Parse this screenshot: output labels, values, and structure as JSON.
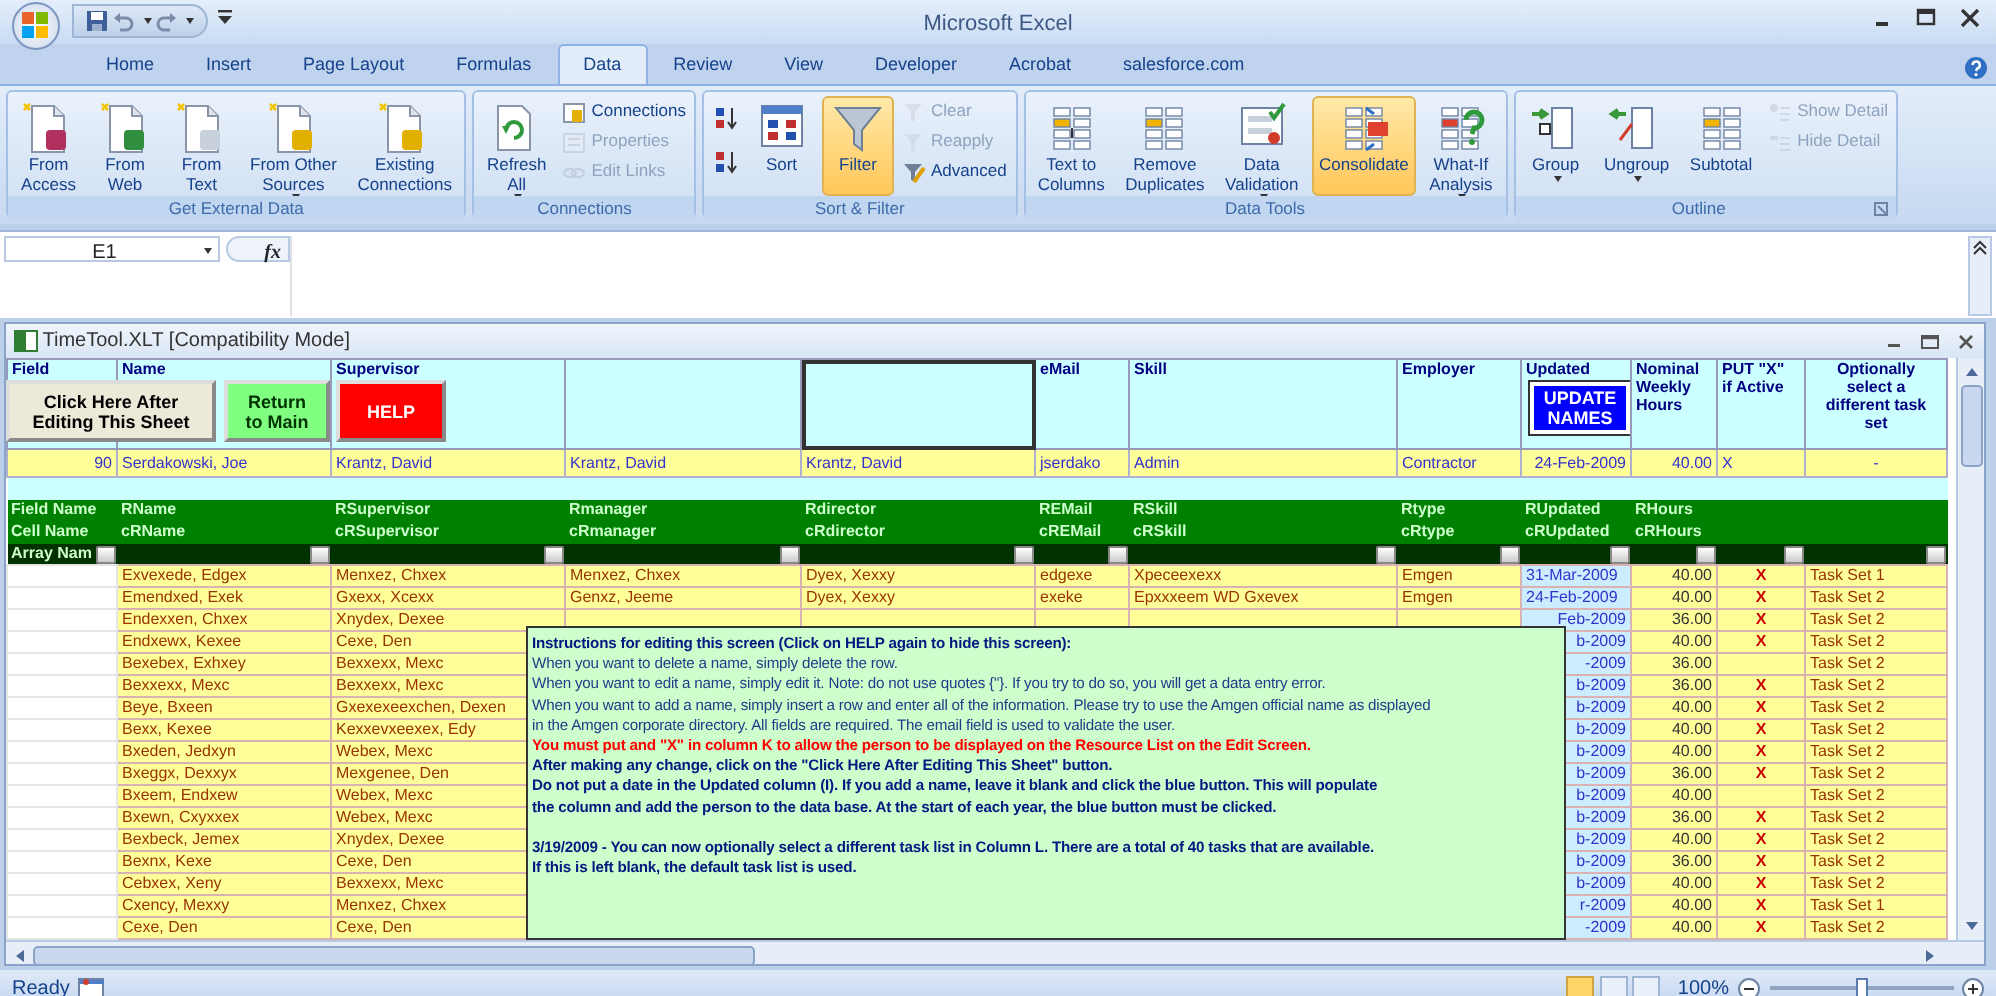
{
  "title_bar": {
    "title": "Microsoft Excel"
  },
  "tabs": [
    {
      "label": "Home",
      "selected": false
    },
    {
      "label": "Insert",
      "selected": false
    },
    {
      "label": "Page Layout",
      "selected": false
    },
    {
      "label": "Formulas",
      "selected": false
    },
    {
      "label": "Data",
      "selected": true
    },
    {
      "label": "Review",
      "selected": false
    },
    {
      "label": "View",
      "selected": false
    },
    {
      "label": "Developer",
      "selected": false
    },
    {
      "label": "Acrobat",
      "selected": false
    },
    {
      "label": "salesforce.com",
      "selected": false
    }
  ],
  "ribbon": [
    {
      "title": "Get External Data",
      "buttons": [
        {
          "kind": "large",
          "label": "From\nAccess",
          "disabled": false,
          "highlighted": false,
          "dropdown": false
        },
        {
          "kind": "large",
          "label": "From\nWeb",
          "disabled": false,
          "highlighted": false,
          "dropdown": false
        },
        {
          "kind": "large",
          "label": "From\nText",
          "disabled": false,
          "highlighted": false,
          "dropdown": false
        },
        {
          "kind": "large",
          "label": "From Other\nSources",
          "disabled": false,
          "highlighted": false,
          "dropdown": true
        },
        {
          "kind": "large",
          "label": "Existing\nConnections",
          "disabled": false,
          "highlighted": false,
          "dropdown": false
        }
      ]
    },
    {
      "title": "Connections",
      "buttons": [
        {
          "kind": "large",
          "label": "Refresh\nAll",
          "disabled": false,
          "highlighted": false,
          "dropdown": true
        },
        {
          "kind": "small",
          "label": "Connections",
          "disabled": false,
          "highlighted": false,
          "dropdown": false
        },
        {
          "kind": "small",
          "label": "Properties",
          "disabled": true,
          "highlighted": false,
          "dropdown": false
        },
        {
          "kind": "small",
          "label": "Edit Links",
          "disabled": true,
          "highlighted": false,
          "dropdown": false
        }
      ]
    },
    {
      "title": "Sort & Filter",
      "buttons": [
        {
          "kind": "icon",
          "disabled": false,
          "highlighted": false,
          "dropdown": false
        },
        {
          "kind": "icon",
          "disabled": false,
          "highlighted": false,
          "dropdown": false
        },
        {
          "kind": "large",
          "label": "Sort",
          "disabled": false,
          "highlighted": false,
          "dropdown": false
        },
        {
          "kind": "large",
          "label": "Filter",
          "disabled": false,
          "highlighted": true,
          "dropdown": false
        },
        {
          "kind": "small",
          "label": "Clear",
          "disabled": true,
          "highlighted": false,
          "dropdown": false
        },
        {
          "kind": "small",
          "label": "Reapply",
          "disabled": true,
          "highlighted": false,
          "dropdown": false
        },
        {
          "kind": "small",
          "label": "Advanced",
          "disabled": false,
          "highlighted": false,
          "dropdown": false
        }
      ]
    },
    {
      "title": "Data Tools",
      "buttons": [
        {
          "kind": "large",
          "label": "Text to\nColumns",
          "disabled": false,
          "highlighted": false,
          "dropdown": false
        },
        {
          "kind": "large",
          "label": "Remove\nDuplicates",
          "disabled": false,
          "highlighted": false,
          "dropdown": false
        },
        {
          "kind": "large",
          "label": "Data\nValidation",
          "disabled": false,
          "highlighted": false,
          "dropdown": true
        },
        {
          "kind": "large",
          "label": "Consolidate",
          "disabled": false,
          "highlighted": true,
          "dropdown": false
        },
        {
          "kind": "large",
          "label": "What-If\nAnalysis",
          "disabled": false,
          "highlighted": false,
          "dropdown": true
        }
      ]
    },
    {
      "title": "Outline",
      "buttons": [
        {
          "kind": "large",
          "label": "Group",
          "disabled": false,
          "highlighted": false,
          "dropdown": true
        },
        {
          "kind": "large",
          "label": "Ungroup",
          "disabled": false,
          "highlighted": false,
          "dropdown": true
        },
        {
          "kind": "large",
          "label": "Subtotal",
          "disabled": false,
          "highlighted": false,
          "dropdown": false
        },
        {
          "kind": "small",
          "label": "Show Detail",
          "disabled": true,
          "highlighted": false,
          "dropdown": false
        },
        {
          "kind": "small",
          "label": "Hide Detail",
          "disabled": true,
          "highlighted": false,
          "dropdown": false
        }
      ]
    }
  ],
  "formula_bar": {
    "name_box": "E1",
    "function_label": "fx"
  },
  "workbook": {
    "title": "TimeTool.XLT  [Compatibility Mode]"
  },
  "sheet_buttons": [
    {
      "kind": "beige",
      "label": "Click Here After\nEditing This Sheet"
    },
    {
      "kind": "green",
      "label": "Return\nto Main"
    },
    {
      "kind": "red",
      "label": "HELP"
    },
    {
      "kind": "blue",
      "label": "UPDATE\nNAMES"
    }
  ],
  "header_row": [
    {
      "text": "Field",
      "selected": false
    },
    {
      "text": "Name",
      "selected": false
    },
    {
      "text": "Supervisor",
      "selected": false
    },
    {
      "selected": false
    },
    {
      "selected": true
    },
    {
      "text": "eMail",
      "selected": false
    },
    {
      "text": "Skill",
      "selected": false
    },
    {
      "text": "Employer",
      "selected": false
    },
    {
      "text": "Updated",
      "selected": false
    },
    {
      "text": "Nominal\nWeekly\nHours",
      "selected": false
    },
    {
      "text": "PUT \"X\"\nif Active",
      "selected": false
    },
    {
      "text": "Optionally\nselect a\ndifferent task\nset",
      "selected": false
    }
  ],
  "record_row": [
    "90",
    "Serdakowski, Joe",
    "Krantz, David",
    "Krantz, David",
    "Krantz, David",
    "jserdako",
    "Admin",
    "Contractor",
    "24-Feb-2009",
    "40.00",
    "X",
    "-"
  ],
  "field_rows": [
    [
      "Field Name",
      "RName",
      "RSupervisor",
      "Rmanager",
      "Rdirector",
      "REMail",
      "RSkill",
      "Rtype",
      "RUpdated",
      "RHours"
    ],
    [
      "Cell Name",
      "cRName",
      "cRSupervisor",
      "cRmanager",
      "cRdirector",
      "cREMail",
      "cRSkill",
      "cRtype",
      "cRUpdated",
      "cRHours"
    ],
    [
      "Array Nam"
    ]
  ],
  "data_rows": [
    {
      "name": "Exvexede, Edgex",
      "supervisor": "Menxez, Chxex",
      "manager": "Menxez, Chxex",
      "director": "Dyex, Xexxy",
      "email": "edgexe",
      "skill": "Xpeceexexx",
      "type": "Emgen",
      "updated": "31-Mar-2009",
      "hours": "40.00",
      "active": "X",
      "task_set": "Task Set 1"
    },
    {
      "name": "Emendxed, Exek",
      "supervisor": "Gxexx, Xcexx",
      "manager": "Genxz, Jeeme",
      "director": "Dyex, Xexxy",
      "email": "exeke",
      "skill": "Epxxxeem WD Gxevex",
      "type": "Emgen",
      "updated": "24-Feb-2009",
      "hours": "40.00",
      "active": "X",
      "task_set": "Task Set 2"
    },
    {
      "name": "Endexxen, Chxex",
      "supervisor": "Xnydex, Dexee",
      "updated": "Feb-2009",
      "hours": "36.00",
      "active": "X",
      "task_set": "Task Set 2"
    },
    {
      "name": "Endxewx, Kexee",
      "supervisor": "Cexe, Den",
      "updated": "b-2009",
      "hours": "40.00",
      "active": "X",
      "task_set": "Task Set 2"
    },
    {
      "name": "Bexebex, Exhxey",
      "supervisor": "Bexxexx, Mexc",
      "updated": "-2009",
      "hours": "36.00",
      "task_set": "Task Set 2"
    },
    {
      "name": "Bexxexx, Mexc",
      "supervisor": "Bexxexx, Mexc",
      "updated": "b-2009",
      "hours": "36.00",
      "active": "X",
      "task_set": "Task Set 2"
    },
    {
      "name": "Beye, Bxeen",
      "supervisor": "Gxexexeexchen, Dexen",
      "updated": "b-2009",
      "hours": "40.00",
      "active": "X",
      "task_set": "Task Set 2"
    },
    {
      "name": "Bexx, Kexee",
      "supervisor": "Kexxevxeexex, Edy",
      "updated": "b-2009",
      "hours": "40.00",
      "active": "X",
      "task_set": "Task Set 2"
    },
    {
      "name": "Bxeden, Jedxyn",
      "supervisor": "Webex, Mexc",
      "updated": "b-2009",
      "hours": "40.00",
      "active": "X",
      "task_set": "Task Set 2"
    },
    {
      "name": "Bxeggx, Dexxyx",
      "supervisor": "Mexgenee, Den",
      "updated": "b-2009",
      "hours": "36.00",
      "active": "X",
      "task_set": "Task Set 2"
    },
    {
      "name": "Bxeem, Endxew",
      "supervisor": "Webex, Mexc",
      "updated": "b-2009",
      "hours": "40.00",
      "task_set": "Task Set 2"
    },
    {
      "name": "Bxewn, Cxyxxex",
      "supervisor": "Webex, Mexc",
      "updated": "b-2009",
      "hours": "36.00",
      "active": "X",
      "task_set": "Task Set 2"
    },
    {
      "name": "Bexbeck, Jemex",
      "supervisor": "Xnydex, Dexee",
      "updated": "b-2009",
      "hours": "40.00",
      "active": "X",
      "task_set": "Task Set 2"
    },
    {
      "name": "Bexnx, Kexe",
      "supervisor": "Cexe, Den",
      "updated": "b-2009",
      "hours": "36.00",
      "active": "X",
      "task_set": "Task Set 2"
    },
    {
      "name": "Cebxex, Xeny",
      "supervisor": "Bexxexx, Mexc",
      "updated": "b-2009",
      "hours": "40.00",
      "active": "X",
      "task_set": "Task Set 2"
    },
    {
      "name": "Cxency, Mexxy",
      "supervisor": "Menxez, Chxex",
      "updated": "r-2009",
      "hours": "40.00",
      "active": "X",
      "task_set": "Task Set 1"
    },
    {
      "name": "Cexe, Den",
      "supervisor": "Cexe, Den",
      "updated": "-2009",
      "hours": "40.00",
      "active": "X",
      "task_set": "Task Set 2"
    }
  ],
  "instructions": [
    [
      {
        "kind": "heading",
        "text": "Instructions for editing this screen (Click on HELP again to hide this screen):"
      },
      {
        "kind": "normal",
        "text": "When you want to delete a name, simply delete the row."
      },
      {
        "kind": "normal",
        "text": "When you want to edit a name, simply edit it.  Note: do not use quotes {\"}.  If you try to do so, you will get a data entry error."
      },
      {
        "kind": "normal",
        "text": "When you want to add a name, simply insert a row and enter all of the information.  Please try to use the Amgen official name as displayed"
      },
      {
        "kind": "normal",
        "text": "in the Amgen corporate directory.  All fields are required.  The email field is used to validate the user."
      },
      {
        "kind": "warning",
        "text": "You must put and \"X\" in column K to allow the person to be displayed on the Resource List on the Edit Screen."
      },
      {
        "kind": "bold",
        "text": "After making any change, click on the \"Click Here After Editing This Sheet\"  button."
      },
      {
        "kind": "bold",
        "text": "Do not put a date in the Updated column (I).  If you add a name, leave it blank and click the blue button.  This will populate"
      },
      {
        "kind": "bold",
        "text": "the column and add the person to the data base.  At the start of each year, the blue button must be clicked."
      }
    ],
    [
      {
        "kind": "bold",
        "text": "3/19/2009 - You can now optionally select a different task list in Column L. There are a total of 40 tasks that are available."
      },
      {
        "kind": "bold",
        "text": "If this is left blank, the default task list is used."
      }
    ]
  ],
  "status_bar": {
    "status": "Ready",
    "views": [
      {
        "selected": true
      },
      {
        "selected": false
      },
      {
        "selected": false
      }
    ],
    "zoom": "100%",
    "zoom_slider": {
      "level": 0.5
    }
  }
}
